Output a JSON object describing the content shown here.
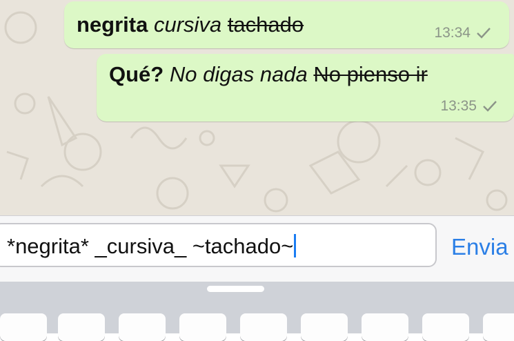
{
  "messages": [
    {
      "segments": [
        {
          "style": "bold",
          "text": "negrita"
        },
        {
          "style": "plain",
          "text": " "
        },
        {
          "style": "italic",
          "text": "cursiva"
        },
        {
          "style": "plain",
          "text": " "
        },
        {
          "style": "strike",
          "text": "tachado"
        }
      ],
      "time": "13:34",
      "status_icon": "single-check-icon"
    },
    {
      "segments": [
        {
          "style": "bold",
          "text": "Qué?"
        },
        {
          "style": "plain",
          "text": " "
        },
        {
          "style": "italic",
          "text": "No digas nada"
        },
        {
          "style": "plain",
          "text": " "
        },
        {
          "style": "strike",
          "text": "No pienso ir"
        }
      ],
      "time": "13:35",
      "status_icon": "single-check-icon"
    }
  ],
  "composer": {
    "input_value": "*negrita* _cursiva_ ~tachado~",
    "send_label": "Envia"
  },
  "colors": {
    "chat_background": "#e9e4db",
    "outgoing_bubble": "#dcf8c6",
    "send_button": "#2b7fe6",
    "keyboard_background": "#cfd2d8"
  }
}
